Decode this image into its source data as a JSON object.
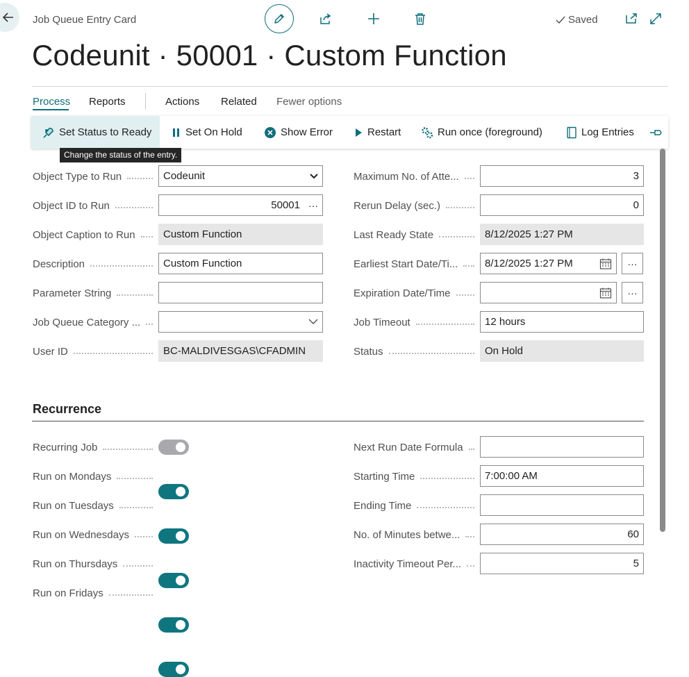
{
  "header": {
    "page_type": "Job Queue Entry Card",
    "saved_label": "Saved",
    "title": "Codeunit · 50001 · Custom Function"
  },
  "tabs": [
    {
      "label": "Process",
      "active": true
    },
    {
      "label": "Reports"
    },
    {
      "label": "Actions"
    },
    {
      "label": "Related"
    },
    {
      "label": "Fewer options"
    }
  ],
  "actions": [
    {
      "label": "Set Status to Ready",
      "icon": "set-ready-icon"
    },
    {
      "label": "Set On Hold",
      "icon": "pause-icon"
    },
    {
      "label": "Show Error",
      "icon": "error-icon"
    },
    {
      "label": "Restart",
      "icon": "play-icon"
    },
    {
      "label": "Run once (foreground)",
      "icon": "run-gears-icon"
    },
    {
      "label": "Log Entries",
      "icon": "log-icon"
    }
  ],
  "tooltip": "Change the status of the entry.",
  "general": {
    "left": [
      {
        "label": "Object Type to Run",
        "value": "Codeunit",
        "kind": "select"
      },
      {
        "label": "Object ID to Run",
        "value": "50001",
        "kind": "lookup"
      },
      {
        "label": "Object Caption to Run",
        "value": "Custom Function",
        "kind": "readonly"
      },
      {
        "label": "Description",
        "value": "Custom Function",
        "kind": "text"
      },
      {
        "label": "Parameter String",
        "value": "",
        "kind": "text"
      },
      {
        "label": "Job Queue Category ...",
        "value": "",
        "kind": "dropdown"
      },
      {
        "label": "User ID",
        "value": "BC-MALDIVESGAS\\CFADMIN",
        "kind": "readonly"
      }
    ],
    "right": [
      {
        "label": "Maximum No. of Atte...",
        "value": "3",
        "kind": "number"
      },
      {
        "label": "Rerun Delay (sec.)",
        "value": "0",
        "kind": "number"
      },
      {
        "label": "Last Ready State",
        "value": "8/12/2025 1:27 PM",
        "kind": "readonly"
      },
      {
        "label": "Earliest Start Date/Ti...",
        "value": "8/12/2025 1:27 PM",
        "kind": "datetime"
      },
      {
        "label": "Expiration Date/Time",
        "value": "",
        "kind": "datetime"
      },
      {
        "label": "Job Timeout",
        "value": "12 hours",
        "kind": "text"
      },
      {
        "label": "Status",
        "value": "On Hold",
        "kind": "readonly"
      }
    ]
  },
  "recurrence": {
    "title": "Recurrence",
    "left": [
      {
        "label": "Recurring Job",
        "on": false,
        "disabled": true
      },
      {
        "label": "Run on Mondays",
        "on": true
      },
      {
        "label": "Run on Tuesdays",
        "on": true
      },
      {
        "label": "Run on Wednesdays",
        "on": true
      },
      {
        "label": "Run on Thursdays",
        "on": true
      },
      {
        "label": "Run on Fridays",
        "on": true
      }
    ],
    "right": [
      {
        "label": "Next Run Date Formula",
        "value": "",
        "kind": "text"
      },
      {
        "label": "Starting Time",
        "value": "7:00:00 AM",
        "kind": "text"
      },
      {
        "label": "Ending Time",
        "value": "",
        "kind": "text"
      },
      {
        "label": "No. of Minutes betwe...",
        "value": "60",
        "kind": "number"
      },
      {
        "label": "Inactivity Timeout Per...",
        "value": "5",
        "kind": "number"
      }
    ]
  },
  "colors": {
    "accent": "#0f6e7c",
    "toggle_on": "#0f7680",
    "toggle_off": "#a8a8ad"
  }
}
